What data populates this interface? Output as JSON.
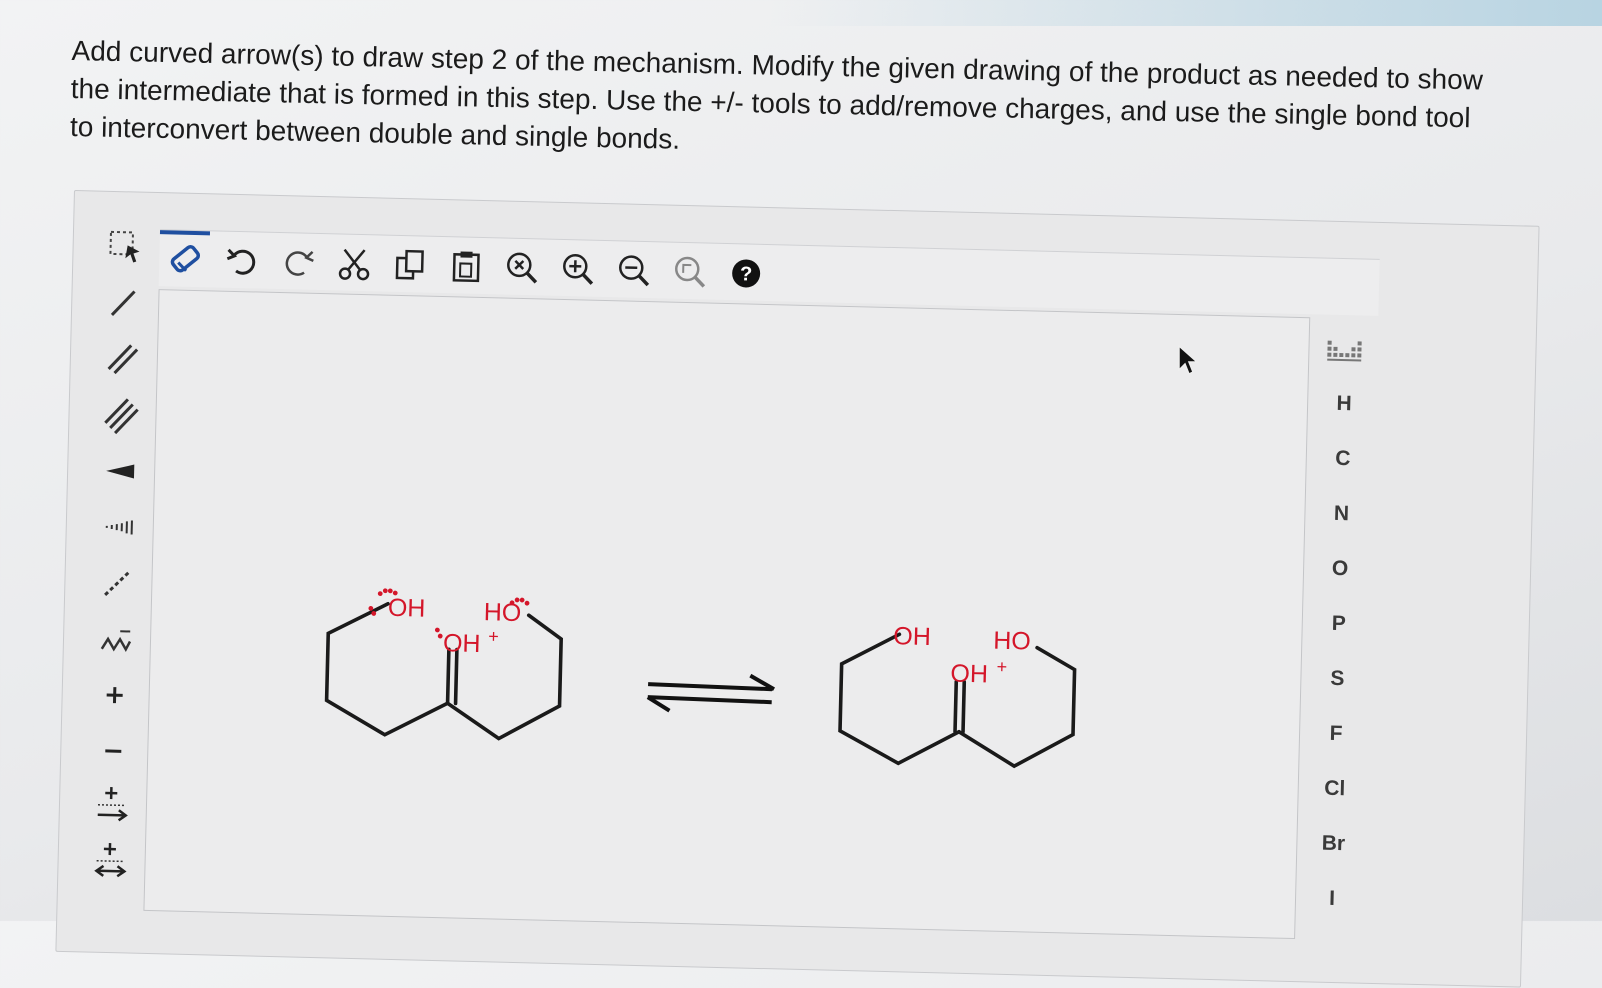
{
  "question": {
    "line1": "Add curved arrow(s) to draw step 2 of the mechanism. Modify the given drawing of the product as needed to show",
    "line2": "the intermediate that is formed in this step. Use the +/- tools to add/remove charges, and use the single bond tool",
    "line3": "to interconvert between double and single bonds."
  },
  "left_toolbar": [
    {
      "name": "select-tool",
      "icon": "marquee-select-icon"
    },
    {
      "name": "single-bond-tool",
      "icon": "single-bond-icon"
    },
    {
      "name": "double-bond-tool",
      "icon": "double-bond-icon"
    },
    {
      "name": "triple-bond-tool",
      "icon": "triple-bond-icon"
    },
    {
      "name": "wedge-bond-tool",
      "icon": "wedge-bond-icon"
    },
    {
      "name": "hash-bond-tool",
      "icon": "hash-bond-icon"
    },
    {
      "name": "dashed-bond-tool",
      "icon": "dashed-bond-icon"
    },
    {
      "name": "chain-tool",
      "icon": "chain-icon"
    },
    {
      "name": "positive-charge-tool",
      "icon": "plus-icon",
      "label": "+"
    },
    {
      "name": "negative-charge-tool",
      "icon": "minus-icon",
      "label": "–"
    },
    {
      "name": "curved-arrow-electron-pair-tool",
      "icon": "arrow-pair-icon"
    },
    {
      "name": "curved-arrow-single-electron-tool",
      "icon": "arrow-single-icon"
    }
  ],
  "top_toolbar": [
    {
      "name": "erase-button",
      "icon": "eraser-icon",
      "active": true
    },
    {
      "name": "undo-button",
      "icon": "undo-icon"
    },
    {
      "name": "redo-button",
      "icon": "redo-icon"
    },
    {
      "name": "cut-button",
      "icon": "scissors-icon"
    },
    {
      "name": "copy-button",
      "icon": "copy-icon"
    },
    {
      "name": "paste-button",
      "icon": "paste-icon"
    },
    {
      "name": "zoom-fit-button",
      "icon": "zoom-reset-icon"
    },
    {
      "name": "zoom-in-button",
      "icon": "zoom-in-icon"
    },
    {
      "name": "zoom-out-button",
      "icon": "zoom-out-icon"
    },
    {
      "name": "zoom-100-button",
      "icon": "zoom-actual-icon"
    },
    {
      "name": "help-button",
      "icon": "help-icon",
      "label": "?"
    }
  ],
  "periodic_table_button": {
    "icon": "periodic-table-icon"
  },
  "atoms": [
    "H",
    "C",
    "N",
    "O",
    "P",
    "S",
    "F",
    "Cl",
    "Br",
    "I"
  ],
  "reactant": {
    "left_oh": "OH",
    "right_ho": "HO",
    "center": "OH",
    "center_charge": "+"
  },
  "product": {
    "left_oh": "OH",
    "right_ho": "HO",
    "center": "OH",
    "center_charge": "+"
  },
  "equilibrium_arrow": {
    "icon": "equilibrium-arrow-icon"
  },
  "colors": {
    "heteroatom": "#d4162a",
    "active_tool": "#1f4fa0",
    "bond": "#1a1a1a"
  }
}
